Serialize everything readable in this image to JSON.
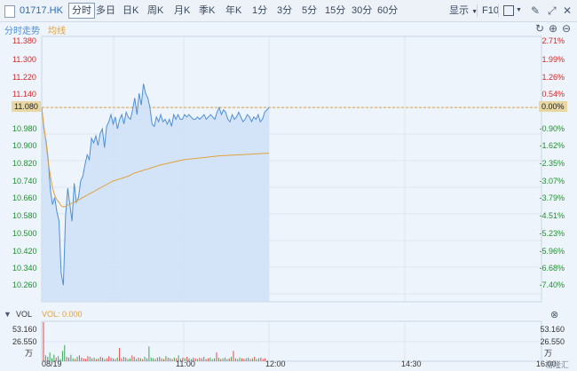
{
  "toolbar": {
    "symbol": "01717.HK",
    "tabs": [
      "分时",
      "多日",
      "日K",
      "周K",
      "月K",
      "季K",
      "年K",
      "1分",
      "3分",
      "5分",
      "15分",
      "30分",
      "60分"
    ],
    "display_label": "显示",
    "f10_label": "F10"
  },
  "legend": {
    "intraday": "分时走势",
    "avg": "均线"
  },
  "y_left": [
    "11.380",
    "11.300",
    "11.220",
    "11.140",
    "11.080",
    "10.980",
    "10.900",
    "10.820",
    "10.740",
    "10.660",
    "10.580",
    "10.500",
    "10.420",
    "10.340",
    "10.260"
  ],
  "y_right": [
    "2.71%",
    "1.99%",
    "1.26%",
    "0.54%",
    "0.00%",
    "-0.90%",
    "-1.62%",
    "-2.35%",
    "-3.07%",
    "-3.79%",
    "-4.51%",
    "-5.23%",
    "-5.96%",
    "-6.68%",
    "-7.40%"
  ],
  "prev_close": "11.080",
  "prev_close_pct": "0.00%",
  "volume": {
    "label": "VOL",
    "vol_value": "VOL: 0.000",
    "ticks": [
      "53.160",
      "26.550",
      "万"
    ]
  },
  "x_labels": [
    "08/19",
    "11:00",
    "12:00",
    "14:30",
    "16:00"
  ],
  "watermark": "格隆汇",
  "colors": {
    "price_line": "#4f8fd6",
    "avg_line": "#e0a13c",
    "fill": "#cfe0f7",
    "up": "#e24b4b",
    "down": "#3aa55a"
  },
  "chart_data": {
    "type": "line",
    "series": [
      {
        "name": "分时走势",
        "values": [
          11.08,
          10.99,
          10.94,
          10.86,
          10.73,
          10.67,
          10.7,
          10.64,
          10.6,
          10.38,
          10.33,
          10.62,
          10.74,
          10.67,
          10.6,
          10.76,
          10.68,
          10.7,
          10.77,
          10.79,
          10.84,
          10.88,
          10.86,
          10.95,
          10.93,
          10.96,
          10.92,
          10.97,
          10.99,
          10.91,
          11.0,
          11.02,
          11.05,
          11.01,
          11.04,
          10.99,
          11.03,
          11.05,
          11.01,
          11.06,
          11.04,
          11.03,
          11.07,
          11.12,
          11.05,
          11.14,
          11.09,
          11.18,
          11.14,
          11.12,
          11.08,
          11.01,
          11.0,
          11.04,
          11.02,
          11.05,
          11.02,
          11.03,
          11.01,
          11.03,
          11.0,
          11.05,
          11.03,
          11.05,
          11.03,
          11.03,
          11.05,
          11.04,
          11.05,
          11.04,
          11.03,
          11.03,
          11.04,
          11.03,
          11.04,
          11.05,
          11.03,
          11.04,
          11.05,
          11.04,
          11.03,
          11.06,
          11.08,
          11.05,
          11.07,
          11.06,
          11.03,
          11.02,
          11.05,
          11.03,
          11.04,
          11.06,
          11.04,
          11.02,
          11.03,
          11.05,
          11.04,
          11.02,
          11.04,
          11.03,
          11.05,
          11.02,
          11.03,
          11.06,
          11.07,
          11.08
        ]
      },
      {
        "name": "均线",
        "values": [
          11.08,
          11.0,
          10.93,
          10.85,
          10.79,
          10.74,
          10.71,
          10.69,
          10.68,
          10.665,
          10.66,
          10.663,
          10.668,
          10.672,
          10.676,
          10.68,
          10.684,
          10.69,
          10.695,
          10.7,
          10.705,
          10.71,
          10.715,
          10.72,
          10.725,
          10.73,
          10.735,
          10.74,
          10.745,
          10.75,
          10.755,
          10.76,
          10.765,
          10.77,
          10.772,
          10.775,
          10.778,
          10.781,
          10.784,
          10.787,
          10.79,
          10.795,
          10.8,
          10.803,
          10.806,
          10.809,
          10.812,
          10.815,
          10.818,
          10.82,
          10.823,
          10.826,
          10.829,
          10.832,
          10.835,
          10.838,
          10.84,
          10.842,
          10.844,
          10.846,
          10.848,
          10.85,
          10.852,
          10.854,
          10.856,
          10.858,
          10.86,
          10.861,
          10.862,
          10.863,
          10.864,
          10.865,
          10.866,
          10.867,
          10.868,
          10.869,
          10.87,
          10.871,
          10.872,
          10.873,
          10.874,
          10.875,
          10.876,
          10.876,
          10.877,
          10.877,
          10.878,
          10.878,
          10.879,
          10.879,
          10.88,
          10.88,
          10.881,
          10.881,
          10.882,
          10.882,
          10.883,
          10.883,
          10.884,
          10.884,
          10.885,
          10.885,
          10.886,
          10.886,
          10.887,
          10.887
        ]
      }
    ],
    "volumes": [
      53.16,
      8,
      6,
      12,
      4,
      9,
      5,
      7,
      3,
      14,
      22,
      6,
      5,
      9,
      4,
      3,
      6,
      8,
      5,
      4,
      3,
      7,
      6,
      4,
      5,
      3,
      4,
      6,
      5,
      3,
      4,
      7,
      5,
      4,
      3,
      5,
      18,
      4,
      6,
      5,
      3,
      4,
      8,
      6,
      3,
      5,
      4,
      3,
      6,
      4,
      20,
      5,
      4,
      3,
      5,
      6,
      4,
      3,
      7,
      5,
      4,
      3,
      5,
      4,
      8,
      3,
      5,
      4,
      6,
      4,
      3,
      5,
      4,
      3,
      5,
      4,
      6,
      3,
      4,
      5,
      3,
      4,
      12,
      5,
      3,
      4,
      5,
      3,
      4,
      6,
      14,
      4,
      3,
      5,
      4,
      3,
      4,
      5,
      3,
      4,
      6,
      3,
      4,
      5,
      3,
      4
    ],
    "ylim": [
      10.26,
      11.38
    ],
    "xlabel": "",
    "ylabel": ""
  }
}
